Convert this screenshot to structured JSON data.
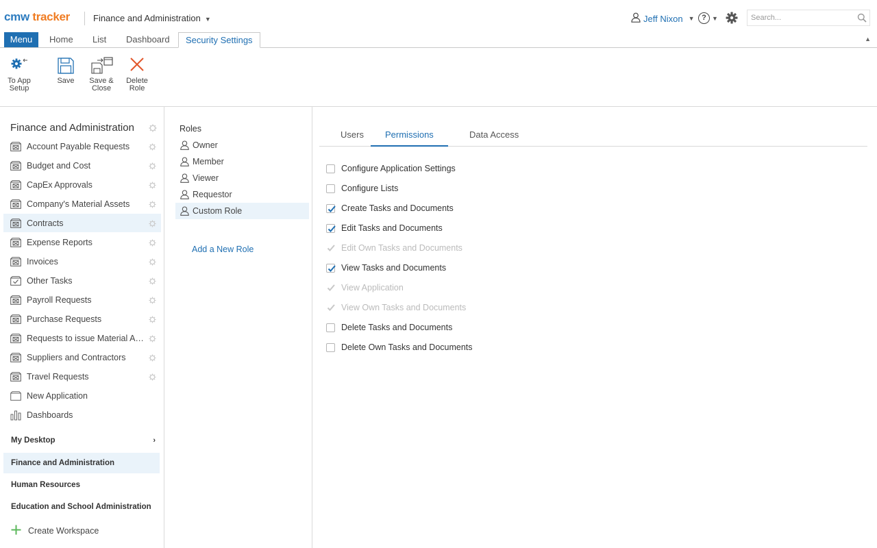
{
  "header": {
    "logo_cmw": "cmw",
    "logo_tracker": "tracker",
    "workspace": "Finance and Administration",
    "user_name": "Jeff Nixon",
    "search_placeholder": "Search..."
  },
  "tabs": {
    "menu": "Menu",
    "items": [
      "Home",
      "List",
      "Dashboard",
      "Security Settings"
    ],
    "active": "Security Settings"
  },
  "toolbar": {
    "to_app_setup_line1": "To App",
    "to_app_setup_line2": "Setup",
    "save": "Save",
    "save_close_line1": "Save &",
    "save_close_line2": "Close",
    "delete_role_line1": "Delete",
    "delete_role_line2": "Role"
  },
  "leftnav": {
    "workspace_title": "Finance and Administration",
    "items": [
      {
        "label": "Account Payable Requests",
        "icon": "app-icon",
        "gear": true
      },
      {
        "label": "Budget and Cost",
        "icon": "app-icon",
        "gear": true
      },
      {
        "label": "CapEx Approvals",
        "icon": "app-icon",
        "gear": true
      },
      {
        "label": "Company's Material Assets",
        "icon": "app-icon",
        "gear": true
      },
      {
        "label": "Contracts",
        "icon": "app-icon",
        "gear": true,
        "selected": true
      },
      {
        "label": "Expense Reports",
        "icon": "app-icon",
        "gear": true
      },
      {
        "label": "Invoices",
        "icon": "app-icon",
        "gear": true
      },
      {
        "label": "Other Tasks",
        "icon": "task-icon",
        "gear": true
      },
      {
        "label": "Payroll Requests",
        "icon": "app-icon",
        "gear": true
      },
      {
        "label": "Purchase Requests",
        "icon": "app-icon",
        "gear": true
      },
      {
        "label": "Requests to issue Material Assets",
        "icon": "app-icon",
        "gear": true
      },
      {
        "label": "Suppliers and Contractors",
        "icon": "app-icon",
        "gear": true
      },
      {
        "label": "Travel Requests",
        "icon": "app-icon",
        "gear": true
      },
      {
        "label": "New Application",
        "icon": "new-app-icon",
        "gear": false
      },
      {
        "label": "Dashboards",
        "icon": "bar-chart-icon",
        "gear": false
      }
    ],
    "workspaces": [
      {
        "label": "My Desktop",
        "arrow": true
      },
      {
        "label": "Finance and Administration",
        "selected": true
      },
      {
        "label": "Human Resources"
      },
      {
        "label": "Education and School Administration"
      }
    ],
    "create_workspace": "Create Workspace"
  },
  "roles": {
    "title": "Roles",
    "items": [
      "Owner",
      "Member",
      "Viewer",
      "Requestor",
      "Custom Role"
    ],
    "selected": "Custom Role",
    "add_role": "Add a New Role"
  },
  "panel": {
    "tabs": [
      "Users",
      "Permissions",
      "Data Access"
    ],
    "active_tab": "Permissions",
    "permissions": [
      {
        "label": "Configure Application Settings",
        "checked": false,
        "disabled": false
      },
      {
        "label": "Configure Lists",
        "checked": false,
        "disabled": false
      },
      {
        "label": "Create Tasks and Documents",
        "checked": true,
        "disabled": false
      },
      {
        "label": "Edit Tasks and Documents",
        "checked": true,
        "disabled": false
      },
      {
        "label": "Edit Own Tasks and Documents",
        "checked": true,
        "disabled": true
      },
      {
        "label": "View Tasks and Documents",
        "checked": true,
        "disabled": false
      },
      {
        "label": "View Application",
        "checked": true,
        "disabled": true
      },
      {
        "label": "View Own Tasks and Documents",
        "checked": true,
        "disabled": true
      },
      {
        "label": "Delete Tasks and Documents",
        "checked": false,
        "disabled": false
      },
      {
        "label": "Delete Own Tasks and Documents",
        "checked": false,
        "disabled": false
      }
    ]
  },
  "colors": {
    "accent": "#1f6fb2",
    "logo_orange": "#f07c22",
    "selected_bg": "#eaf3fa",
    "delete_red": "#e2572b"
  }
}
